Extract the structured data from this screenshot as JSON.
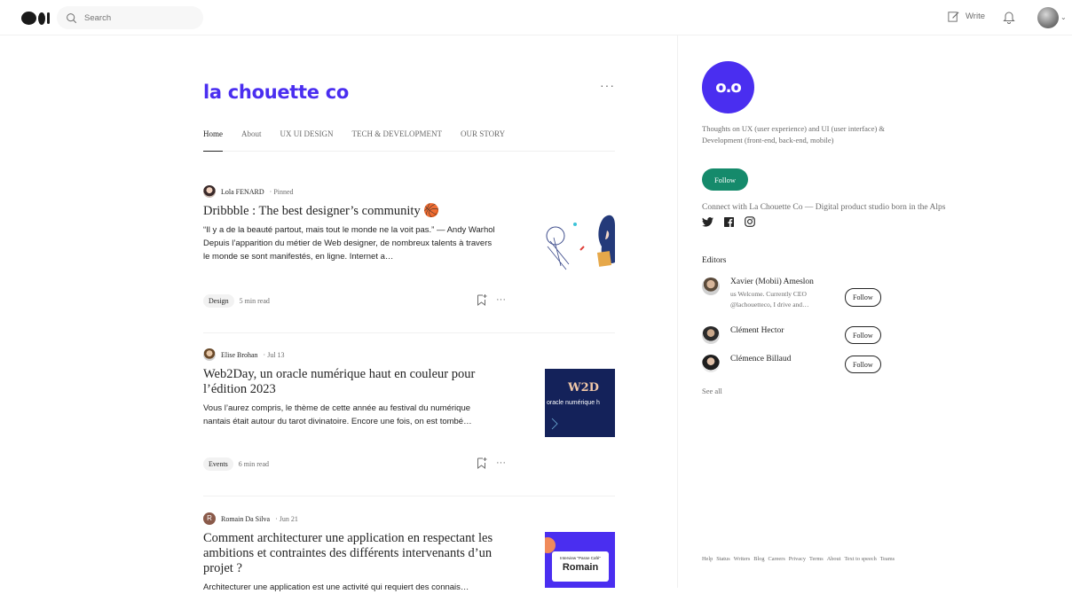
{
  "header": {
    "search_placeholder": "Search",
    "write_label": "Write"
  },
  "publication": {
    "name": "la chouette co",
    "logo_text": "o.o",
    "tabs": [
      "Home",
      "About",
      "UX UI DESIGN",
      "TECH & DEVELOPMENT",
      "OUR STORY"
    ],
    "description": "Thoughts on UX (user experience) and UI (user interface) & Development (front-end, back-end, mobile)",
    "follow_label": "Follow",
    "connect_text": "Connect with La Chouette Co — Digital product studio born in the Alps"
  },
  "articles": [
    {
      "author": "Lola FENARD",
      "meta": "· Pinned",
      "title": "Dribbble : The best designer’s community 🏀",
      "excerpt": "“Il y a de la beauté partout, mais tout le monde ne la voit pas.” — Andy Warhol Depuis l’apparition du métier de Web designer, de nombreux talents à travers le monde se sont manifestés, en ligne. Internet a…",
      "tag": "Design",
      "read": "5 min read"
    },
    {
      "author": "Elise Brohan",
      "meta": "· Jul 13",
      "title": "Web2Day, un oracle numérique haut en couleur pour l’édition 2023",
      "excerpt": "Vous l’aurez compris, le thème de cette année au festival du numérique nantais était autour du tarot divinatoire. Encore une fois, on est tombé…",
      "tag": "Events",
      "read": "6 min read",
      "thumb_title": "W2D",
      "thumb_sub": "oracle numérique h"
    },
    {
      "author": "Romain Da Silva",
      "author_initial": "R",
      "meta": "· Jun 21",
      "title": "Comment architecturer une application en respectant les ambitions et contraintes des différents intervenants d’un projet ?",
      "excerpt": "Architecturer une application est une activité qui requiert des connais…",
      "thumb_small": "Interview \"Passe Café\"",
      "thumb_name": "Romain"
    }
  ],
  "editors": {
    "heading": "Editors",
    "list": [
      {
        "name": "Xavier (Mobii) Ameslon",
        "bio": "us Welcome. Currently CEO @lachouetteco, I drive and…",
        "follow": "Follow"
      },
      {
        "name": "Clément Hector",
        "follow": "Follow"
      },
      {
        "name": "Clémence Billaud",
        "follow": "Follow"
      }
    ],
    "see_all": "See all"
  },
  "footer": {
    "links": [
      "Help",
      "Status",
      "Writers",
      "Blog",
      "Careers",
      "Privacy",
      "Terms",
      "About",
      "Text to speech",
      "Teams"
    ]
  },
  "colors": {
    "brand": "#4a2ef0",
    "follow_green": "#158a6b"
  }
}
